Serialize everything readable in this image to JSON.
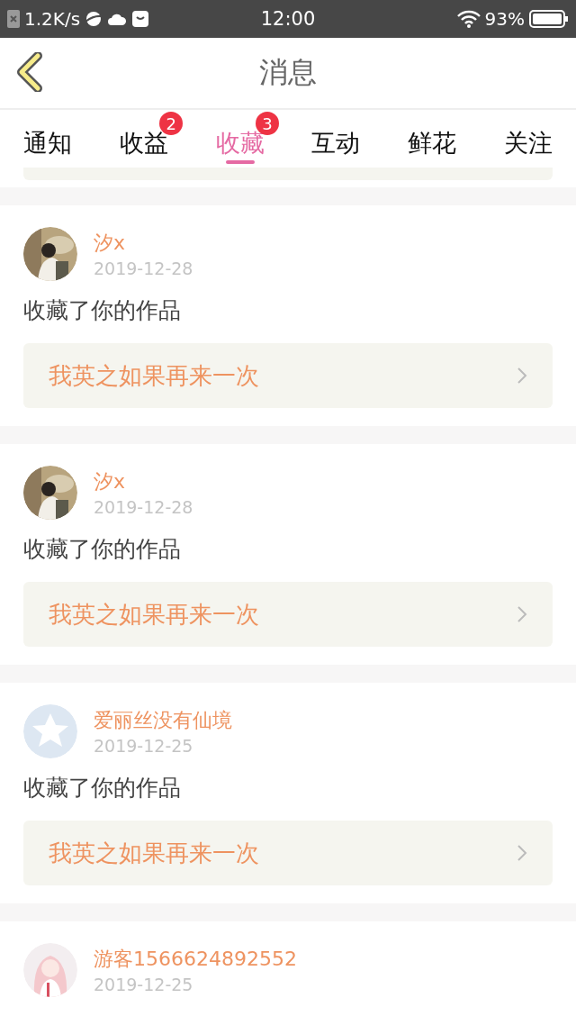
{
  "status_bar": {
    "speed": "1.2K/s",
    "time": "12:00",
    "battery": "93%"
  },
  "header": {
    "title": "消息"
  },
  "tabs": [
    {
      "label": "通知",
      "selected": false
    },
    {
      "label": "收益",
      "selected": false,
      "badge": "2"
    },
    {
      "label": "收藏",
      "selected": true,
      "badge": "3"
    },
    {
      "label": "互动",
      "selected": false
    },
    {
      "label": "鲜花",
      "selected": false
    },
    {
      "label": "关注",
      "selected": false
    }
  ],
  "messages": [
    {
      "user": "汐x",
      "date": "2019-12-28",
      "action": "收藏了你的作品",
      "work": "我英之如果再来一次"
    },
    {
      "user": "汐x",
      "date": "2019-12-28",
      "action": "收藏了你的作品",
      "work": "我英之如果再来一次"
    },
    {
      "avatar": {
        "kind": "default"
      },
      "user": "爱丽丝没有仙境",
      "date": "2019-12-25",
      "action": "收藏了你的作品",
      "work": "我英之如果再来一次"
    },
    {
      "avatar": {
        "kind": "anime"
      },
      "user": "游客1566624892552",
      "date": "2019-12-25"
    }
  ]
}
